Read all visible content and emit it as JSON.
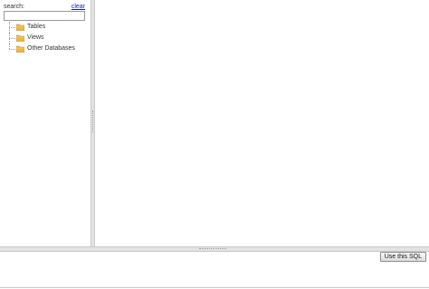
{
  "search": {
    "label": "search:",
    "clear_label": "clear",
    "value": "",
    "placeholder": ""
  },
  "tree": {
    "items": [
      {
        "label": "Tables",
        "icon": "folder-icon"
      },
      {
        "label": "Views",
        "icon": "folder-icon"
      },
      {
        "label": "Other Databases",
        "icon": "folder-icon"
      }
    ]
  },
  "bottom": {
    "use_sql_label": "Use this SQL"
  },
  "colors": {
    "folder": "#e8b84a",
    "link": "#1a1aa6",
    "splitter": "#e3e3e3"
  }
}
